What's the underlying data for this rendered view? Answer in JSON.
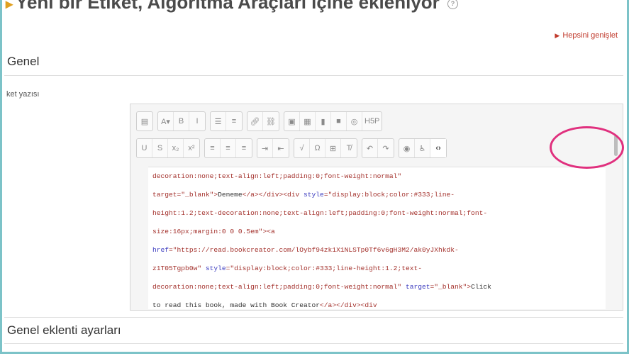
{
  "page": {
    "title": "Yeni bir Etiket, Algoritma Araçları içine ekleniyor",
    "help_icon": "question-circle-icon",
    "expand_all": "Hepsini genişlet"
  },
  "sections": {
    "general": "Genel",
    "plugin_settings": "Genel eklenti ayarları"
  },
  "form": {
    "label_text_label": "ket yazısı"
  },
  "editor": {
    "toolbar_row1": [
      [
        "collapse-icon"
      ],
      [
        "font-style-icon",
        "bold-icon",
        "italic-icon"
      ],
      [
        "unordered-list-icon",
        "ordered-list-icon"
      ],
      [
        "link-icon",
        "unlink-icon"
      ],
      [
        "image-icon",
        "media-icon",
        "file-icon",
        "video-icon",
        "record-icon",
        "h5p-icon"
      ]
    ],
    "toolbar_row2": [
      [
        "underline-icon",
        "strikethrough-icon",
        "subscript-icon",
        "superscript-icon"
      ],
      [
        "align-left-icon",
        "align-center-icon",
        "align-right-icon"
      ],
      [
        "indent-icon",
        "outdent-icon"
      ],
      [
        "equation-icon",
        "special-char-icon",
        "table-icon",
        "clear-format-icon"
      ],
      [
        "undo-icon",
        "redo-icon"
      ],
      [
        "accessibility-checker-icon",
        "screenreader-helper-icon",
        "html-toggle-icon"
      ]
    ],
    "h5p_label": "H5P",
    "font_label": "A",
    "code_lines": [
      [
        [
          "c-red",
          "decoration:none;text-align:left;padding:0;font-weight:normal\""
        ]
      ],
      [
        [
          "c-red",
          "target=\"_blank\">"
        ],
        [
          "c-dark",
          "Deneme"
        ],
        [
          "c-red",
          "</a></div><div "
        ],
        [
          "c-blue",
          "style"
        ],
        [
          "c-red",
          "=\"display:block;color:#333;line-"
        ]
      ],
      [
        [
          "c-red",
          "height:1.2;text-decoration:none;text-align:left;padding:0;font-weight:normal;font-"
        ]
      ],
      [
        [
          "c-red",
          "size:16px;margin:0 0 0.5em\"><a"
        ]
      ],
      [
        [
          "c-blue",
          "href"
        ],
        [
          "c-red",
          "=\"https://read.bookcreator.com/lOybf94zk1X1NLSTp0Tf6v6gH3M2/ak0yJXhkdk-"
        ]
      ],
      [
        [
          "c-red",
          "z1T05Tgpb0w\" "
        ],
        [
          "c-blue",
          "style"
        ],
        [
          "c-red",
          "=\"display:block;color:#333;line-height:1.2;text-"
        ]
      ],
      [
        [
          "c-red",
          "decoration:none;text-align:left;padding:0;font-weight:normal\" "
        ],
        [
          "c-blue",
          "target"
        ],
        [
          "c-red",
          "=\"_blank\">"
        ],
        [
          "c-dark",
          "Click"
        ]
      ],
      [
        [
          "c-dark",
          "to read this book, made with Book Creator"
        ],
        [
          "c-red",
          "</a></div><div"
        ]
      ]
    ]
  },
  "colors": {
    "frame_border": "#7cc3c8",
    "highlight_ring": "#e0307e",
    "expand_link": "#c0392b"
  }
}
